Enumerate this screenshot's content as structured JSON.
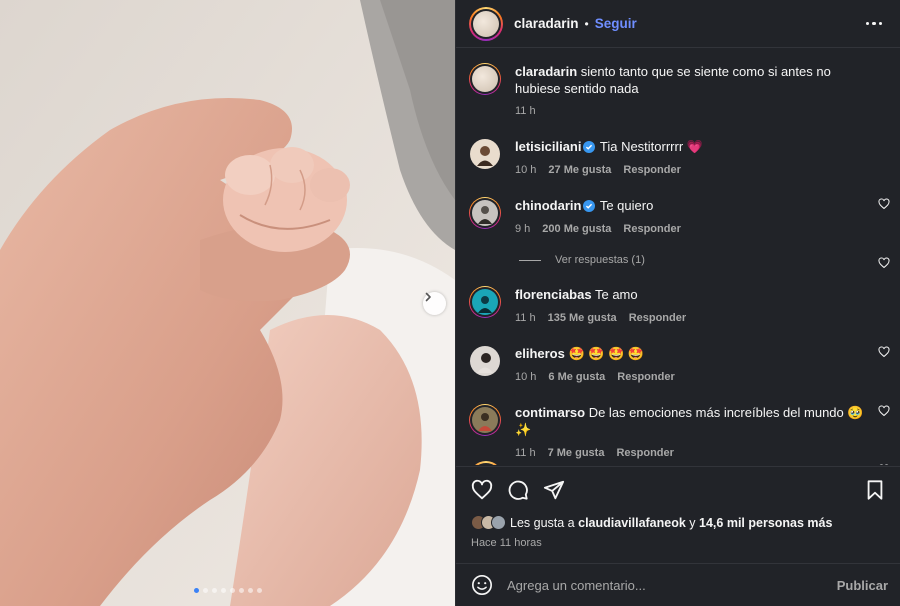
{
  "post": {
    "author": "claradarin",
    "separator": "•",
    "follow_label": "Seguir",
    "caption": "siento tanto que se siente como si antes no hubiese sentido nada",
    "caption_time": "11 h"
  },
  "carousel": {
    "slide_count": 8,
    "active_index": 0,
    "next_icon": "chevron-right-icon"
  },
  "comments": [
    {
      "user": "letisiciliani",
      "verified": true,
      "text": "Tia Nestitorrrrr",
      "emoji": "💗",
      "time": "10 h",
      "likes": "27 Me gusta",
      "reply": "Responder"
    },
    {
      "user": "chinodarin",
      "verified": true,
      "text": "Te quiero",
      "emoji": "",
      "time": "9 h",
      "likes": "200 Me gusta",
      "reply": "Responder"
    },
    {
      "user": "florenciabas",
      "verified": false,
      "text": "Te amo",
      "emoji": "",
      "time": "11 h",
      "likes": "135 Me gusta",
      "reply": "Responder"
    },
    {
      "user": "eliheros",
      "verified": false,
      "text": "",
      "emoji": "🤩 🤩 🤩 🤩",
      "time": "10 h",
      "likes": "6 Me gusta",
      "reply": "Responder"
    },
    {
      "user": "contimarso",
      "verified": false,
      "text": "De las emociones más increíbles del mundo",
      "emoji": "🥹 ✨",
      "time": "11 h",
      "likes": "7 Me gusta",
      "reply": "Responder"
    }
  ],
  "replies_toggle": "Ver respuestas (1)",
  "likes": {
    "prefix": "Les gusta a",
    "user": "claudiavillafaneok",
    "connector": "y",
    "count": "14,6 mil personas más"
  },
  "timestamp": "Hace 11 horas",
  "composer": {
    "placeholder": "Agrega un comentario...",
    "publish": "Publicar"
  },
  "colors": {
    "panel_bg": "#212328",
    "accent": "#6f8eff",
    "muted": "#a8a8a8",
    "verified": "#3897f0"
  }
}
